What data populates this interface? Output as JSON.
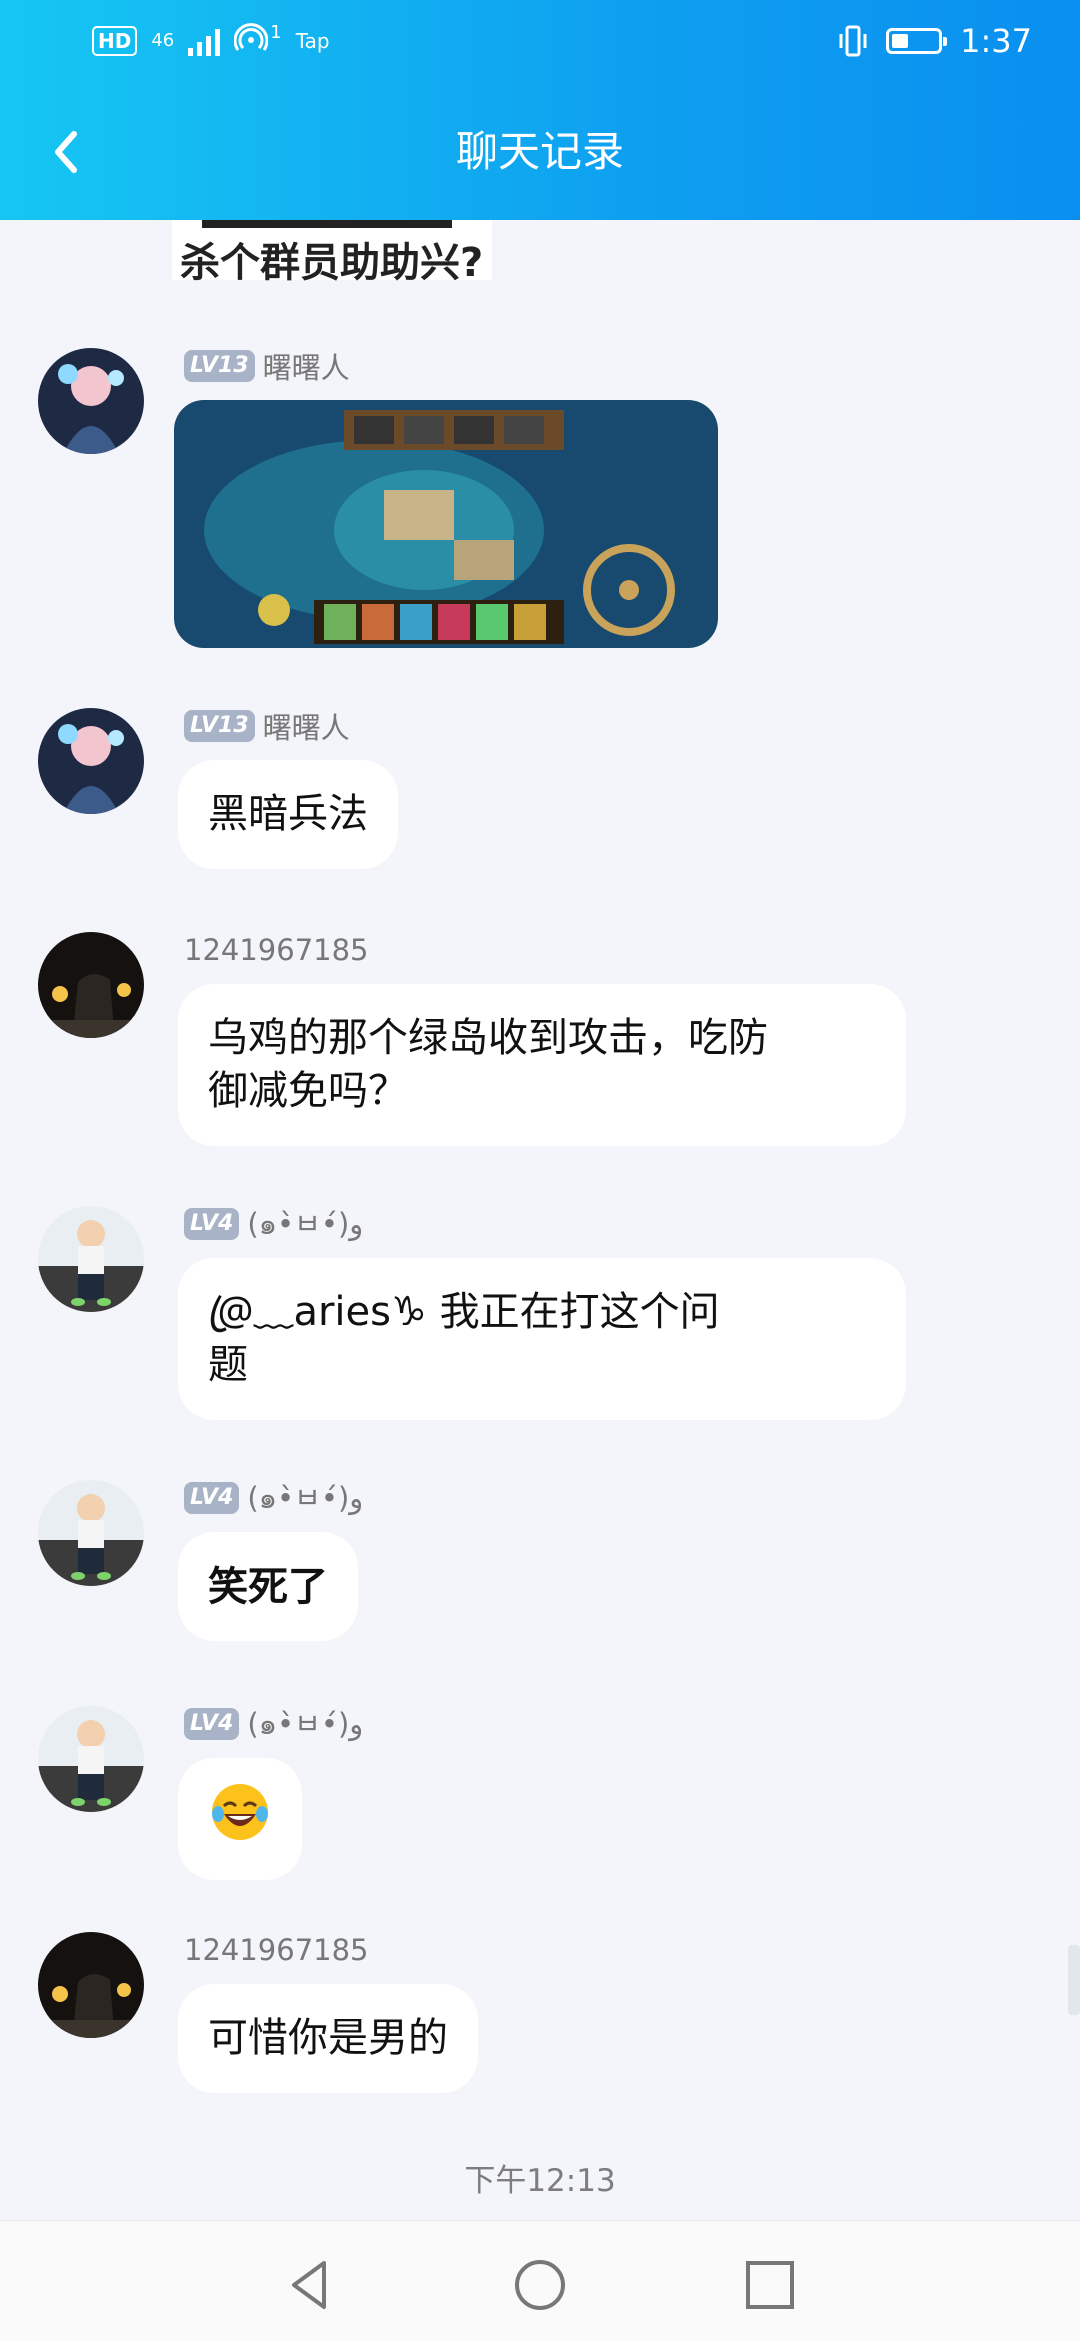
{
  "status_bar": {
    "network_badge": "HD",
    "network_type": "46",
    "hotspot_count": "1",
    "tap_label": "Tap",
    "time": "1:37"
  },
  "header": {
    "title": "聊天记录",
    "back_icon": "chevron-left-icon"
  },
  "top_image_caption": "杀个群员助助兴?",
  "messages": [
    {
      "sender_level": "LV13",
      "sender_name": "曙曙人",
      "type": "image",
      "image_desc": "game-screenshot"
    },
    {
      "sender_level": "LV13",
      "sender_name": "曙曙人",
      "type": "text",
      "text": "黑暗兵法"
    },
    {
      "sender_level": "",
      "sender_name": "1241967185",
      "type": "text",
      "text_lines": [
        "乌鸡的那个绿岛收到攻击，吃防",
        "御减免吗？"
      ]
    },
    {
      "sender_level": "LV4",
      "sender_name": "(๑•̀ㅂ•́)و",
      "type": "text",
      "text_lines": [
        "@ꦿ﹏aries♑ 我正在打这个问",
        "题"
      ]
    },
    {
      "sender_level": "LV4",
      "sender_name": "(๑•̀ㅂ•́)و",
      "type": "text",
      "text": "笑死了"
    },
    {
      "sender_level": "LV4",
      "sender_name": "(๑•̀ㅂ•́)و",
      "type": "emoji",
      "text": "😂"
    },
    {
      "sender_level": "",
      "sender_name": "1241967185",
      "type": "text",
      "text": "可惜你是男的"
    }
  ],
  "time_divider": "下午12:13",
  "system_nav": {
    "back": "triangle-back-icon",
    "home": "circle-home-icon",
    "recents": "square-recents-icon"
  }
}
